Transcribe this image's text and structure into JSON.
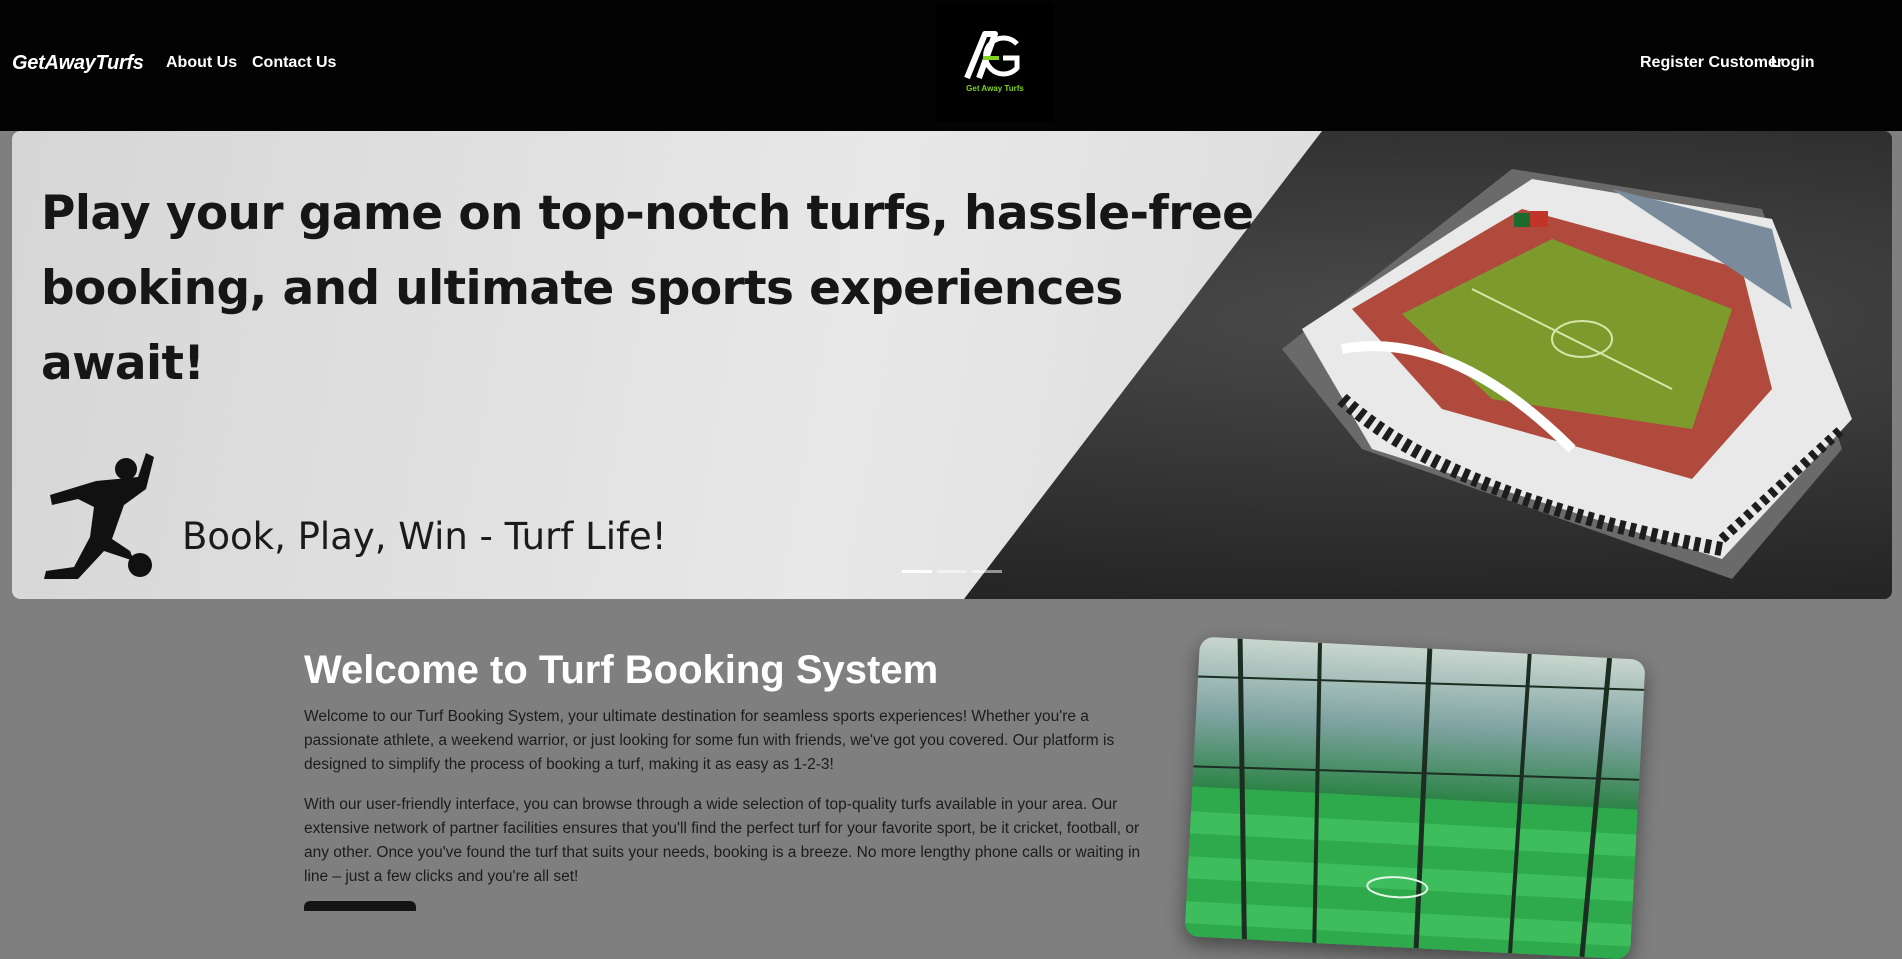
{
  "nav": {
    "brand": "GetAwayTurfs",
    "about": "About Us",
    "contact": "Contact Us",
    "register": "Register Customer",
    "login": "Login",
    "logo_caption": "Get Away Turfs"
  },
  "hero": {
    "headline": "Play your game on top-notch turfs, hassle-free booking, and ultimate sports experiences await!",
    "tagline": "Book, Play, Win - Turf Life!",
    "slide_count": 3,
    "active_slide": 1
  },
  "welcome": {
    "title": "Welcome to Turf Booking System",
    "paragraph1": "Welcome to our Turf Booking System, your ultimate destination for seamless sports experiences! Whether you're a passionate athlete, a weekend warrior, or just looking for some fun with friends, we've got you covered. Our platform is designed to simplify the process of booking a turf, making it as easy as 1-2-3!",
    "paragraph2": "With our user-friendly interface, you can browse through a wide selection of top-quality turfs available in your area. Our extensive network of partner facilities ensures that you'll find the perfect turf for your favorite sport, be it cricket, football, or any other. Once you've found the turf that suits your needs, booking is a breeze. No more lengthy phone calls or waiting in line – just a few clicks and you're all set!"
  },
  "colors": {
    "navbar": "#030303",
    "page_background": "#7f7f7f",
    "logo_accent": "#7ed321"
  }
}
